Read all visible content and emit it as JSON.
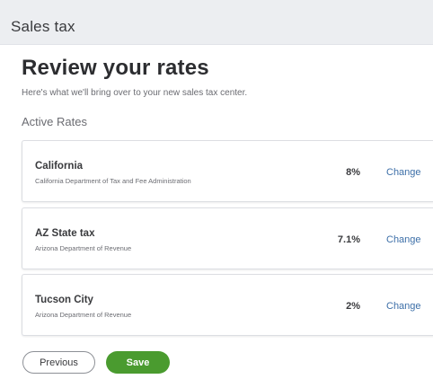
{
  "header": {
    "title": "Sales tax"
  },
  "main": {
    "page_title": "Review your rates",
    "subtitle": "Here's what we'll bring over to your new sales tax center.",
    "section_title": "Active Rates",
    "rates": [
      {
        "name": "California",
        "agency": "California Department of Tax and Fee Administration",
        "rate": "8%",
        "action": "Change"
      },
      {
        "name": "AZ State tax",
        "agency": "Arizona Department of Revenue",
        "rate": "7.1%",
        "action": "Change"
      },
      {
        "name": "Tucson City",
        "agency": "Arizona Department of Revenue",
        "rate": "2%",
        "action": "Change"
      }
    ]
  },
  "footer": {
    "previous_label": "Previous",
    "save_label": "Save"
  },
  "colors": {
    "header_bg": "#eceef1",
    "link": "#3d6fa8",
    "save_button": "#4a9b2f"
  }
}
